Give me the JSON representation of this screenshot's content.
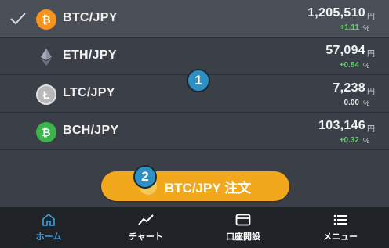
{
  "markets": [
    {
      "pair": "BTC/JPY",
      "price": "1,205,510",
      "yen": "円",
      "change": "+1.11",
      "pct": "%",
      "selected": true,
      "coin_letter": "₿",
      "coin_color": "#f7931a",
      "change_color": "green"
    },
    {
      "pair": "ETH/JPY",
      "price": "57,094",
      "yen": "円",
      "change": "+0.84",
      "pct": "%",
      "selected": false,
      "coin_letter": "",
      "coin_color": "",
      "change_color": "green"
    },
    {
      "pair": "LTC/JPY",
      "price": "7,238",
      "yen": "円",
      "change": "0.00",
      "pct": "%",
      "selected": false,
      "coin_letter": "Ł",
      "coin_color": "#b8b8b8",
      "change_color": "gray"
    },
    {
      "pair": "BCH/JPY",
      "price": "103,146",
      "yen": "円",
      "change": "+0.32",
      "pct": "%",
      "selected": false,
      "coin_letter": "₿",
      "coin_color": "#3cb44a",
      "change_color": "green"
    }
  ],
  "markers": {
    "one": "1",
    "two": "2"
  },
  "order_button": {
    "label": "BTC/JPY  注文"
  },
  "nav": {
    "home": "ホーム",
    "chart": "チャート",
    "account": "口座開設",
    "menu": "メニュー"
  },
  "colors": {
    "accent": "#3aa0e4",
    "order": "#f2a81c",
    "positive": "#5fd06a"
  },
  "icons": [
    "check-icon",
    "bitcoin-icon",
    "ethereum-icon",
    "litecoin-icon",
    "bitcoin-cash-icon",
    "home-icon",
    "chart-line-icon",
    "card-icon",
    "list-icon"
  ]
}
